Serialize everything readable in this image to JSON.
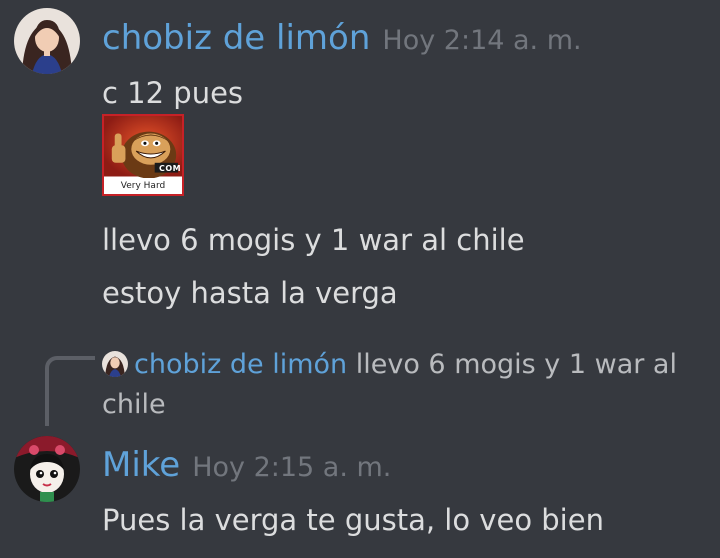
{
  "messages": [
    {
      "author": "chobiz de limón",
      "timestamp": "Hoy 2:14 a. m.",
      "lines": [
        "c 12 pues",
        "llevo 6 mogis y 1 war al chile",
        "estoy hasta la verga"
      ],
      "sticker": {
        "badge": "COM",
        "caption": "Very Hard",
        "icon": "donkey-kong-thumbs-up"
      }
    },
    {
      "author": "Mike",
      "timestamp": "Hoy 2:15 a. m.",
      "reply_to": {
        "author": "chobiz de limón",
        "text": "llevo 6 mogis y 1 war al chile"
      },
      "lines": [
        "Pues la verga te gusta, lo veo bien"
      ]
    }
  ],
  "colors": {
    "background": "#36393f",
    "username": "#5fa2d9",
    "timestamp": "#72767d",
    "text": "#dcddde",
    "reply_line": "#5c5f66"
  }
}
